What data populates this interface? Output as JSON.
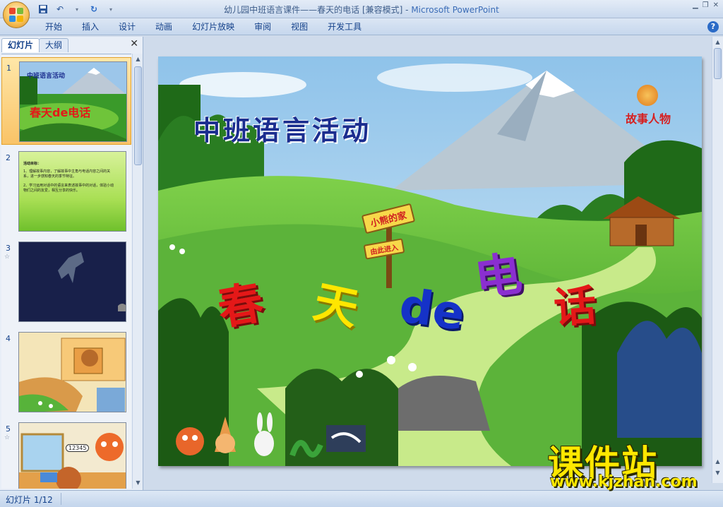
{
  "window": {
    "title": "幼儿园中班语言课件——春天的电话 [兼容模式] - ",
    "app_name": "Microsoft PowerPoint"
  },
  "ribbon": {
    "tabs": [
      "开始",
      "插入",
      "设计",
      "动画",
      "幻灯片放映",
      "审阅",
      "视图",
      "开发工具"
    ]
  },
  "panel": {
    "tab_slides": "幻灯片",
    "tab_outline": "大纲",
    "close": "✕"
  },
  "thumbnails": [
    {
      "num": "1",
      "mini_title": "中班语言活动",
      "mini_word": "春天de电话"
    },
    {
      "num": "2",
      "lines": [
        "活动目标：",
        "1、理解故事内容，了解故事中主角与电话内容之间的关系，进一步感知春天的季节特征。",
        "2、学习运用对话中的语言来表述故事中的对话，体验小动物们之间的友爱，相互分享的快乐。"
      ]
    },
    {
      "num": "3"
    },
    {
      "num": "4"
    },
    {
      "num": "5",
      "phone_number": "12345"
    }
  ],
  "slide": {
    "title": "中班语言活动",
    "story_label": "故事人物",
    "sign_main": "小熊的家",
    "sign_sub": "由此进入",
    "words": [
      "春",
      "天",
      "de",
      "电",
      "话"
    ]
  },
  "watermark": {
    "main": "课件站",
    "url": "www.kjzhan.com"
  },
  "status": {
    "slide_info": "幻灯片 1/12"
  },
  "colors": {
    "word1": "#e41818",
    "word2": "#ffe600",
    "word3": "#1532c8",
    "word4": "#8a2fd0",
    "word5": "#e41818",
    "title": "#1b2d8f"
  }
}
